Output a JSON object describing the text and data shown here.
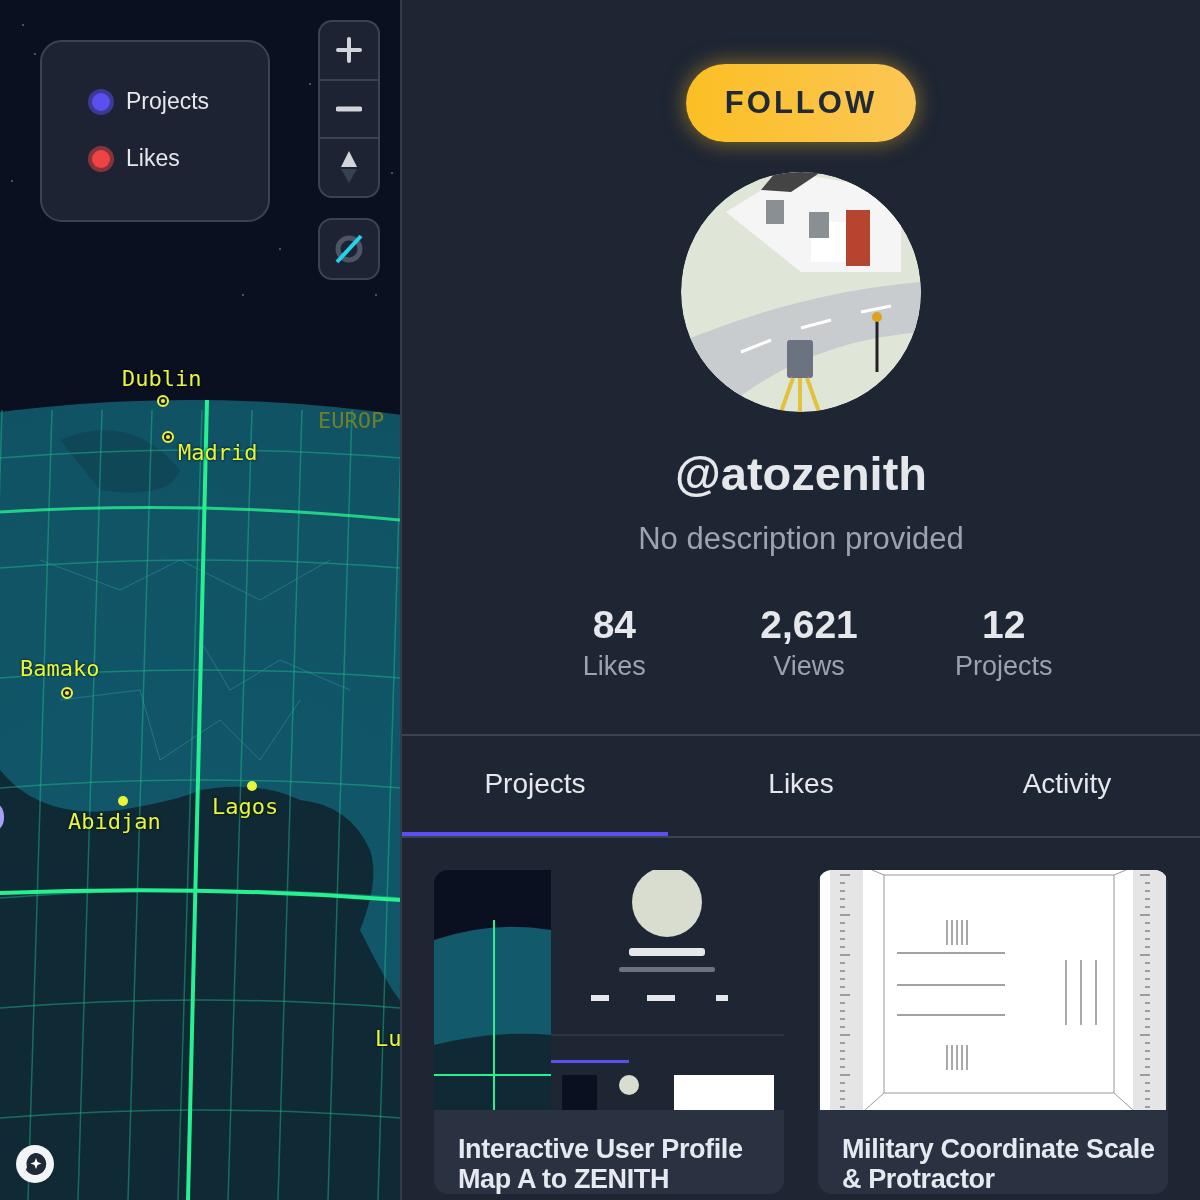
{
  "map": {
    "legend": [
      {
        "label": "Projects",
        "color": "#5b4ff0"
      },
      {
        "label": "Likes",
        "color": "#ef4444"
      }
    ],
    "places": [
      {
        "name": "Dublin",
        "kind": "ring"
      },
      {
        "name": "Madrid",
        "kind": "ring"
      },
      {
        "name": "EUROP",
        "kind": "region"
      },
      {
        "name": "Bamako",
        "kind": "ring"
      },
      {
        "name": "Abidjan",
        "kind": "dot"
      },
      {
        "name": "Lagos",
        "kind": "dot"
      },
      {
        "name": "Lu",
        "kind": "plain"
      }
    ]
  },
  "profile": {
    "follow_button": "FOLLOW",
    "username": "@atozenith",
    "description": "No description provided",
    "stats": [
      {
        "value": "84",
        "label": "Likes"
      },
      {
        "value": "2,621",
        "label": "Views"
      },
      {
        "value": "12",
        "label": "Projects"
      }
    ],
    "tabs": [
      {
        "label": "Projects",
        "selected": true
      },
      {
        "label": "Likes",
        "selected": false
      },
      {
        "label": "Activity",
        "selected": false
      }
    ],
    "projects": [
      {
        "title": "Interactive User Profile Map A to ZENITH",
        "kind": "app"
      },
      {
        "title": "Military Coordinate Scale & Protractor",
        "kind": "sheet"
      }
    ]
  }
}
